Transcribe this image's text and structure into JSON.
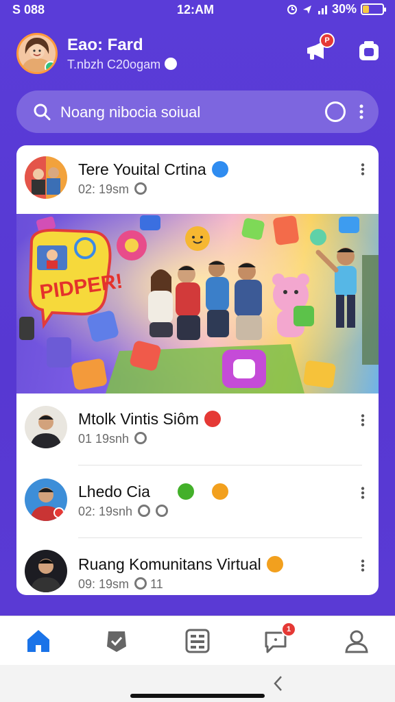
{
  "status_bar": {
    "left_text": "S 088",
    "time": "12:AM",
    "battery": "30%",
    "battery_level": 0.3
  },
  "header": {
    "user_name": "Eao: Fard",
    "user_subtitle": "T.nbzh C20ogam"
  },
  "search": {
    "placeholder": "Noang nibocia soiual"
  },
  "posts": [
    {
      "name": "Tere Youital Crtina",
      "time": "02: 19sm",
      "badge_color": "#2f8cf0"
    },
    {
      "name": "Mtolk Vintis Siôm",
      "time": "01 19snh",
      "badge_color": "#e53935"
    },
    {
      "name": "Lhedo Cia",
      "time": "02: 19snh",
      "badge_color": "#43b02a"
    },
    {
      "name": "Ruang Komunitans Virtual",
      "time": "09: 19sm",
      "extra": "11",
      "badge_color": "#f2a01e"
    }
  ],
  "hero": {
    "sign_text": "PIDPER!"
  },
  "nav": {
    "items": [
      "home",
      "community",
      "apps",
      "messages",
      "profile"
    ],
    "messages_badge": "1"
  },
  "colors": {
    "background": "#5a3cd8",
    "accent": "#1a73e8",
    "badge_red": "#e53935"
  }
}
